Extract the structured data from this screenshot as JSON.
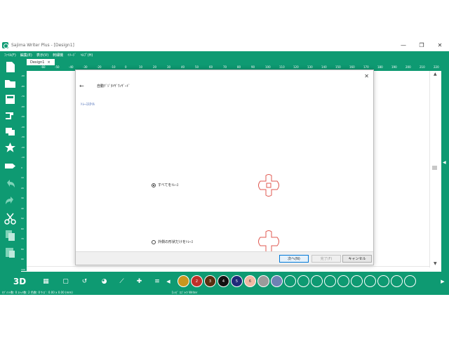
{
  "window": {
    "title": "Sajima Writer Plus - [Design1]",
    "controls": [
      "—",
      "❐",
      "✕"
    ]
  },
  "menu": [
    "ﾌｧｲﾙ(F)",
    "編集(E)",
    "表示(V)",
    "刺繍機",
    "ｲﾒｰｼﾞ",
    "ﾍﾙﾌﾟ(H)"
  ],
  "tab": {
    "label": "Design1",
    "close": "×"
  },
  "ruler_top_labels": [
    "-60",
    "-50",
    "-40",
    "-30",
    "-20",
    "-10",
    "0",
    "10",
    "20",
    "30",
    "40",
    "50",
    "60",
    "70",
    "80",
    "90",
    "100",
    "110",
    "120",
    "130",
    "140",
    "150",
    "160",
    "170",
    "180",
    "190",
    "200",
    "210",
    "220"
  ],
  "ruler_left_labels": [
    "-90",
    "-80",
    "-70",
    "-60",
    "-50",
    "-40",
    "-30",
    "-20",
    "-10",
    "0",
    "10",
    "20",
    "30",
    "40",
    "50",
    "60",
    "70",
    "80",
    "90",
    "100"
  ],
  "left_tools": [
    "new-file-icon",
    "open-folder-icon",
    "save-icon",
    "sew-machine-icon",
    "send-icon",
    "star-icon",
    "transfer-icon",
    "undo-icon",
    "redo-icon",
    "cut-icon",
    "copy-icon",
    "paste-icon"
  ],
  "bottom_tools": {
    "view3d": "3D",
    "grid": "▦",
    "frame": "▢",
    "fit": "↺",
    "stitch": "◕",
    "trace": "⟋",
    "puzzle": "✚",
    "list": "≡",
    "prev": "◀",
    "next": "▶"
  },
  "thread_colors": [
    {
      "num": "1",
      "color": "#c9971f",
      "text": "#c9971f"
    },
    {
      "num": "2",
      "color": "#c0302a",
      "text": "#ffffff"
    },
    {
      "num": "3",
      "color": "#5a2e10",
      "text": "#ffffff"
    },
    {
      "num": "4",
      "color": "#111111",
      "text": "#ffffff"
    },
    {
      "num": "5",
      "color": "#1f2a7a",
      "text": "#ffffff"
    },
    {
      "num": "6",
      "color": "#f0b8a3",
      "text": "#333333"
    },
    {
      "num": "7",
      "color": "#9b9b9b",
      "text": "#9b9b9b"
    },
    {
      "num": "8",
      "color": "#6e82b4",
      "text": "#6e82b4"
    }
  ],
  "empty_swatches": 10,
  "status": {
    "left": "ｾｸﾞﾒﾝﾄ数: 0  ｽﾃｯﾁ数: 2  色数: 0  ｻｲｽﾞ: 0.00 x 0.00 (mm)",
    "mid": "[ﾚｼﾋﾟ ﾛｺﾞﾗｲｸ Writer"
  },
  "dialog": {
    "back": "←",
    "title": "自動ﾃﾞｼﾞﾀｲｻﾞｳｨｻﾞｰﾄﾞ",
    "close": "✕",
    "section": "ﾄﾚｰｽｽﾀｲﾙ",
    "options": [
      {
        "label": "すべてをﾄﾚｰｽ",
        "checked": true
      },
      {
        "label": "外側の形状だけをﾄﾚｰｽ",
        "checked": false
      }
    ],
    "buttons": {
      "next": "次へ(N)",
      "finish": "完了(F)",
      "cancel": "キャンセル"
    },
    "accent": "#e05a52"
  },
  "colors": {
    "brand": "#0e9a72"
  }
}
